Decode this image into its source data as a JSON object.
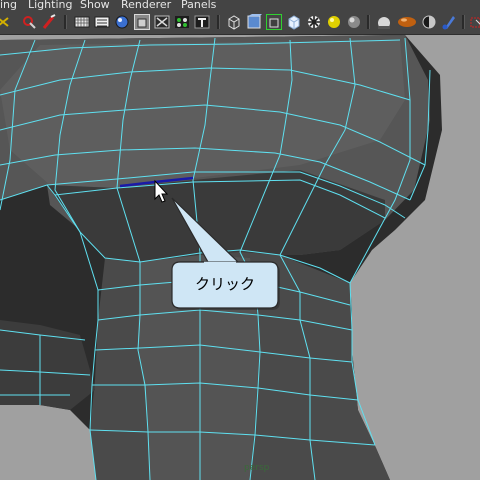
{
  "menu": {
    "items": [
      "ing",
      "Lighting",
      "Show",
      "Renderer",
      "Panels"
    ]
  },
  "toolbar": {
    "icons": [
      "select-camera-icon",
      "bookmark-icon",
      "image-plane-icon",
      "grid-icon",
      "smooth-shade-icon",
      "wireframe-on-shaded-icon",
      "xray-icon",
      "isolate-icon",
      "textured-icon",
      "wireframe-icon",
      "shaded-cube-icon",
      "frame-selection-icon",
      "backface-icon",
      "checker-icon",
      "light-icon",
      "sphere-icon",
      "material-ball-icon",
      "toggle-icon",
      "half-sphere-icon",
      "hypershade-icon",
      "render-icon"
    ]
  },
  "viewport": {
    "camera_label": "persp",
    "callout_text": "クリック",
    "colors": {
      "background": "#a0a0a0",
      "mesh_face": "#505050",
      "mesh_wire": "#5fe0f0",
      "selected_edge": "#1a1aa8",
      "callout_fill": "#cfe6f5",
      "callout_border": "#2a2a2a"
    }
  }
}
